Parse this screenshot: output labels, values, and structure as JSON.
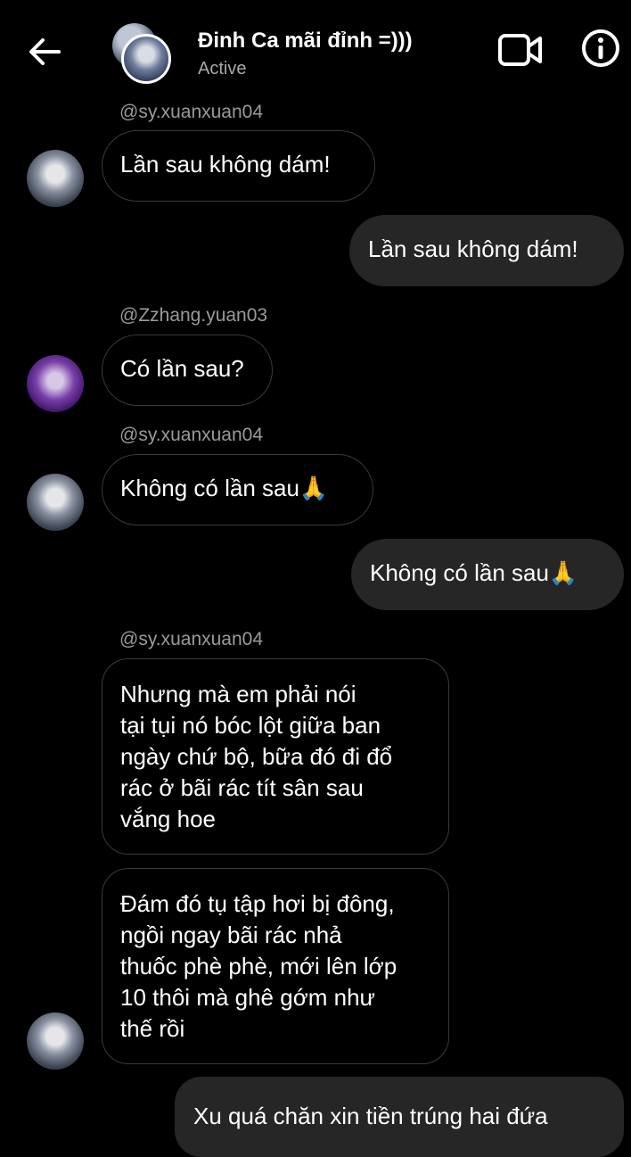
{
  "header": {
    "title": "Đinh Ca mãi đỉnh =)))",
    "status": "Active"
  },
  "messages": [
    {
      "handle": "@sy.xuanxuan04",
      "text": "Lần sau không dám!"
    },
    {
      "text": "Lần sau không dám!"
    },
    {
      "handle": "@Zzhang.yuan03",
      "text": "Có lần sau?"
    },
    {
      "handle": "@sy.xuanxuan04",
      "text": "Không có lần sau🙏"
    },
    {
      "text": "Không có lần sau🙏"
    },
    {
      "handle": "@sy.xuanxuan04",
      "lines": [
        "Nhưng mà em phải nói",
        "tại tụi nó bóc lột giữa ban",
        "ngày chứ bộ, bữa đó đi đổ",
        "rác ở bãi rác tít sân sau",
        "vắng hoe"
      ]
    },
    {
      "lines": [
        "Đám đó tụ tập hơi bị đông,",
        "ngồi ngay bãi rác nhả",
        "thuốc phè phè, mới lên lớp",
        "10 thôi mà ghê gớm như",
        "thế rồi"
      ]
    },
    {
      "text": "Xu quá chăn xin tiền trúng hai đứa"
    }
  ]
}
